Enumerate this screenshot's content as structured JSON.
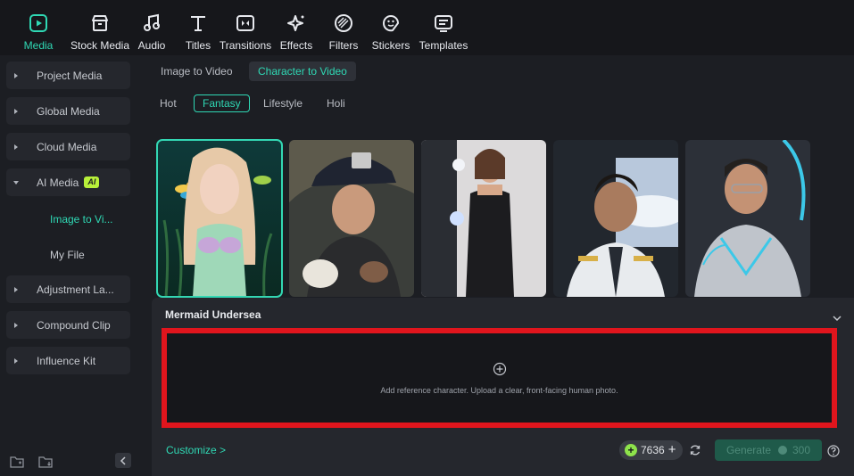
{
  "toolbar": {
    "items": [
      {
        "label": "Media",
        "icon": "media-icon",
        "active": true
      },
      {
        "label": "Stock Media",
        "icon": "stock-media-icon"
      },
      {
        "label": "Audio",
        "icon": "music-note-icon"
      },
      {
        "label": "Titles",
        "icon": "text-t-icon"
      },
      {
        "label": "Transitions",
        "icon": "transitions-icon"
      },
      {
        "label": "Effects",
        "icon": "sparkle-icon"
      },
      {
        "label": "Filters",
        "icon": "filter-icon"
      },
      {
        "label": "Stickers",
        "icon": "sticker-icon"
      },
      {
        "label": "Templates",
        "icon": "templates-icon"
      }
    ]
  },
  "sidebar": {
    "items": [
      {
        "label": "Project Media"
      },
      {
        "label": "Global Media"
      },
      {
        "label": "Cloud Media"
      },
      {
        "label": "AI Media",
        "badge": "AI",
        "expanded": true
      },
      {
        "label": "Adjustment La..."
      },
      {
        "label": "Compound Clip"
      },
      {
        "label": "Influence Kit"
      }
    ],
    "subitems": [
      {
        "label": "Image to Vi...",
        "active": true
      },
      {
        "label": "My File"
      }
    ]
  },
  "main": {
    "tabs": [
      {
        "label": "Image to Video"
      },
      {
        "label": "Character to Video",
        "active": true
      }
    ],
    "categories": [
      {
        "label": "Hot"
      },
      {
        "label": "Fantasy",
        "active": true
      },
      {
        "label": "Lifestyle"
      },
      {
        "label": "Holi"
      }
    ],
    "thumbnails": [
      {
        "name": "mermaid-thumbnail",
        "selected": true
      },
      {
        "name": "firefighter-thumbnail"
      },
      {
        "name": "model-thumbnail"
      },
      {
        "name": "pilot-thumbnail"
      },
      {
        "name": "cyborg-thumbnail"
      }
    ]
  },
  "panel": {
    "title": "Mermaid Undersea",
    "dropzone_text": "Add reference character. Upload a clear, front-facing human photo.",
    "customize_label": "Customize >",
    "credits": "7636",
    "generate_label": "Generate",
    "generate_cost": "300"
  },
  "colors": {
    "accent": "#2fd8b4",
    "highlight_border": "#e0151d",
    "ai_badge": "#b8f03a"
  }
}
